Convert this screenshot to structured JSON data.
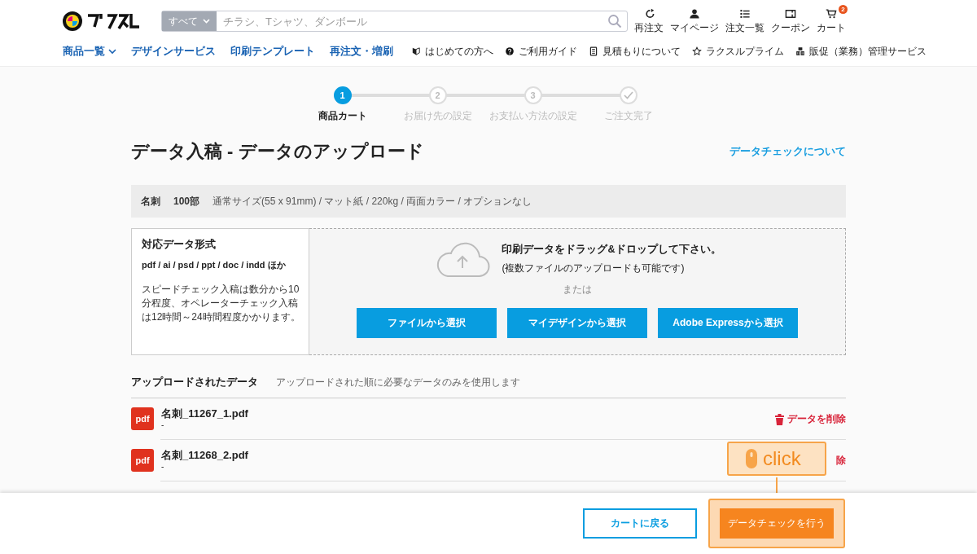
{
  "header": {
    "search": {
      "scope": "すべて",
      "placeholder": "チラシ、Tシャツ、ダンボール"
    },
    "actions": [
      {
        "kind": "reorder",
        "label": "再注文"
      },
      {
        "kind": "mypage",
        "label": "マイページ"
      },
      {
        "kind": "orders",
        "label": "注文一覧"
      },
      {
        "kind": "coupon",
        "label": "クーポン"
      },
      {
        "kind": "cart",
        "label": "カート",
        "badge": "2"
      }
    ],
    "nav": [
      {
        "label": "商品一覧",
        "dropdown": true
      },
      {
        "label": "デザインサービス",
        "dropdown": false
      },
      {
        "label": "印刷テンプレート",
        "dropdown": false
      },
      {
        "label": "再注文・増刷",
        "dropdown": false
      }
    ],
    "links": [
      {
        "kind": "beginner",
        "label": "はじめての方へ"
      },
      {
        "kind": "guide",
        "label": "ご利用ガイド"
      },
      {
        "kind": "estimate",
        "label": "見積もりについて"
      },
      {
        "kind": "prime",
        "label": "ラクスルプライム"
      },
      {
        "kind": "business",
        "label": "販促（業務）管理サービス"
      }
    ]
  },
  "steps": [
    {
      "number": "1",
      "label": "商品カート",
      "selected": true,
      "done": false
    },
    {
      "number": "2",
      "label": "お届け先の設定",
      "selected": false,
      "done": false
    },
    {
      "number": "3",
      "label": "お支払い方法の設定",
      "selected": false,
      "done": false
    },
    {
      "label": "ご注文完了",
      "selected": false,
      "done": true
    }
  ],
  "title": "データ入稿 - データのアップロード",
  "help_link": "データチェックについて",
  "spec": {
    "product": "名刺",
    "quantity": "100部",
    "details": "通常サイズ(55 x 91mm) / マット紙 / 220kg / 両面カラー / オプションなし"
  },
  "formats": {
    "heading": "対応データ形式",
    "types": "pdf / ai / psd / ppt / doc / indd ほか",
    "note": "スピードチェック入稿は数分から10分程度、オペレーターチェック入稿は12時間～24時間程度かかります。"
  },
  "dropzone": {
    "message": "印刷データをドラッグ&ドロップして下さい。",
    "sub": "(複数ファイルのアップロードも可能です)",
    "or": "または",
    "buttons": [
      "ファイルから選択",
      "マイデザインから選択",
      "Adobe Expressから選択"
    ]
  },
  "uploaded": {
    "heading": "アップロードされたデータ",
    "note": "アップロードされた順に必要なデータのみを使用します",
    "files": [
      {
        "badge": "pdf",
        "name": "名刺_11267_1.pdf",
        "sub": "-",
        "delete_label": "データを削除",
        "delete_icon": true
      },
      {
        "badge": "pdf",
        "name": "名刺_11268_2.pdf",
        "sub": "-",
        "delete_label": "除",
        "delete_icon": false
      }
    ]
  },
  "footer": {
    "back": "カートに戻る",
    "submit": "データチェックを行う"
  },
  "callout": {
    "label": "click"
  }
}
